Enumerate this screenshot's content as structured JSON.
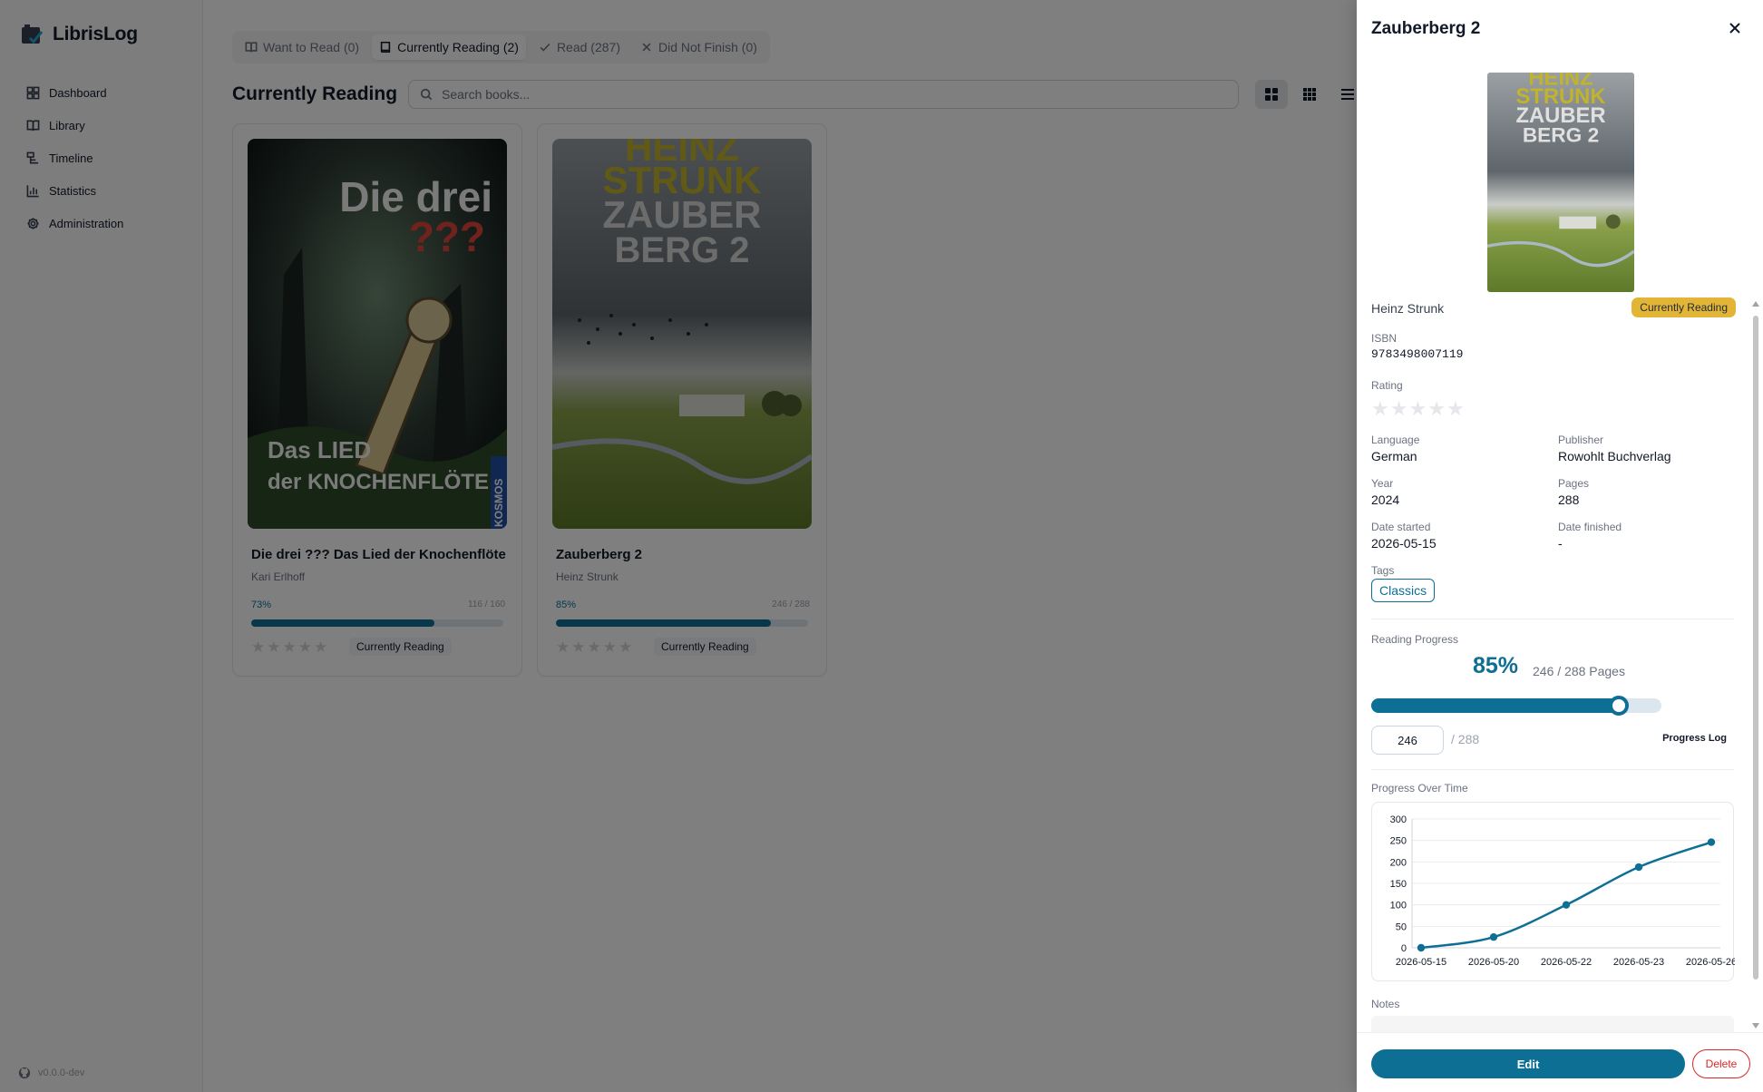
{
  "app": {
    "name": "LibrisLog",
    "version": "v0.0.0-dev"
  },
  "sidebar": {
    "items": [
      {
        "label": "Dashboard",
        "icon": "dashboard-icon"
      },
      {
        "label": "Library",
        "icon": "book-open-icon"
      },
      {
        "label": "Timeline",
        "icon": "timeline-icon"
      },
      {
        "label": "Statistics",
        "icon": "bar-chart-icon"
      },
      {
        "label": "Administration",
        "icon": "gear-icon"
      }
    ]
  },
  "tabs": [
    {
      "label": "Want to Read (0)",
      "icon": "book-open-icon",
      "active": false
    },
    {
      "label": "Currently Reading (2)",
      "icon": "book-icon",
      "active": true
    },
    {
      "label": "Read (287)",
      "icon": "check-icon",
      "active": false
    },
    {
      "label": "Did Not Finish (0)",
      "icon": "x-icon",
      "active": false
    }
  ],
  "main": {
    "title": "Currently Reading",
    "search_placeholder": "Search books..."
  },
  "cards": [
    {
      "title": "Die drei ??? Das Lied der Knochenflöte",
      "author": "Kari Erlhoff",
      "percent_label": "73%",
      "progress": 0.725,
      "pages_label": "116 / 160",
      "rating": 0,
      "status": "Currently Reading",
      "cover": {
        "line1": "Die drei",
        "line2": "???",
        "line3": "Das LIED",
        "line4": "der KNOCHENFLÖTE",
        "side": "KOSMOS"
      }
    },
    {
      "title": "Zauberberg 2",
      "author": "Heinz Strunk",
      "percent_label": "85%",
      "progress": 0.854,
      "pages_label": "246 / 288",
      "rating": 0,
      "status": "Currently Reading",
      "cover": {
        "line1": "HEINZ",
        "line2": "STRUNK",
        "line3": "ZAUBER",
        "line4": "BERG 2"
      }
    }
  ],
  "detail": {
    "title": "Zauberberg 2",
    "author": "Heinz Strunk",
    "status": "Currently Reading",
    "fields": {
      "isbn_label": "ISBN",
      "isbn": "9783498007119",
      "rating_label": "Rating",
      "rating": 0,
      "language_label": "Language",
      "language": "German",
      "publisher_label": "Publisher",
      "publisher": "Rowohlt Buchverlag",
      "year_label": "Year",
      "year": "2024",
      "pages_label": "Pages",
      "pages": "288",
      "started_label": "Date started",
      "started": "2026-05-15",
      "finished_label": "Date finished",
      "finished": "-",
      "tags_label": "Tags"
    },
    "tags": [
      "Classics"
    ],
    "reading_progress": {
      "label": "Reading Progress",
      "percent_label": "85%",
      "pages_text": "246 / 288 Pages",
      "fraction": 0.854,
      "current_page": "246",
      "total_text": "/ 288",
      "progress_log_label": "Progress Log"
    },
    "progress_over_time_label": "Progress Over Time",
    "notes_label": "Notes",
    "edit_label": "Edit",
    "delete_label": "Delete",
    "cover": {
      "line1": "HEINZ",
      "line2": "STRUNK",
      "line3": "ZAUBER",
      "line4": "BERG 2"
    }
  },
  "chart_data": {
    "type": "line",
    "x": [
      "2026-05-15",
      "2026-05-20",
      "2026-05-22",
      "2026-05-23",
      "2026-05-26"
    ],
    "y": [
      0,
      25,
      100,
      188,
      246
    ],
    "ylim": [
      0,
      300
    ],
    "yticks": [
      0,
      50,
      100,
      150,
      200,
      250,
      300
    ],
    "grid": true,
    "color": "#0e6f95"
  },
  "colors": {
    "accent": "#0e6f95",
    "status_badge": "#e2b536",
    "danger": "#dc2626"
  }
}
